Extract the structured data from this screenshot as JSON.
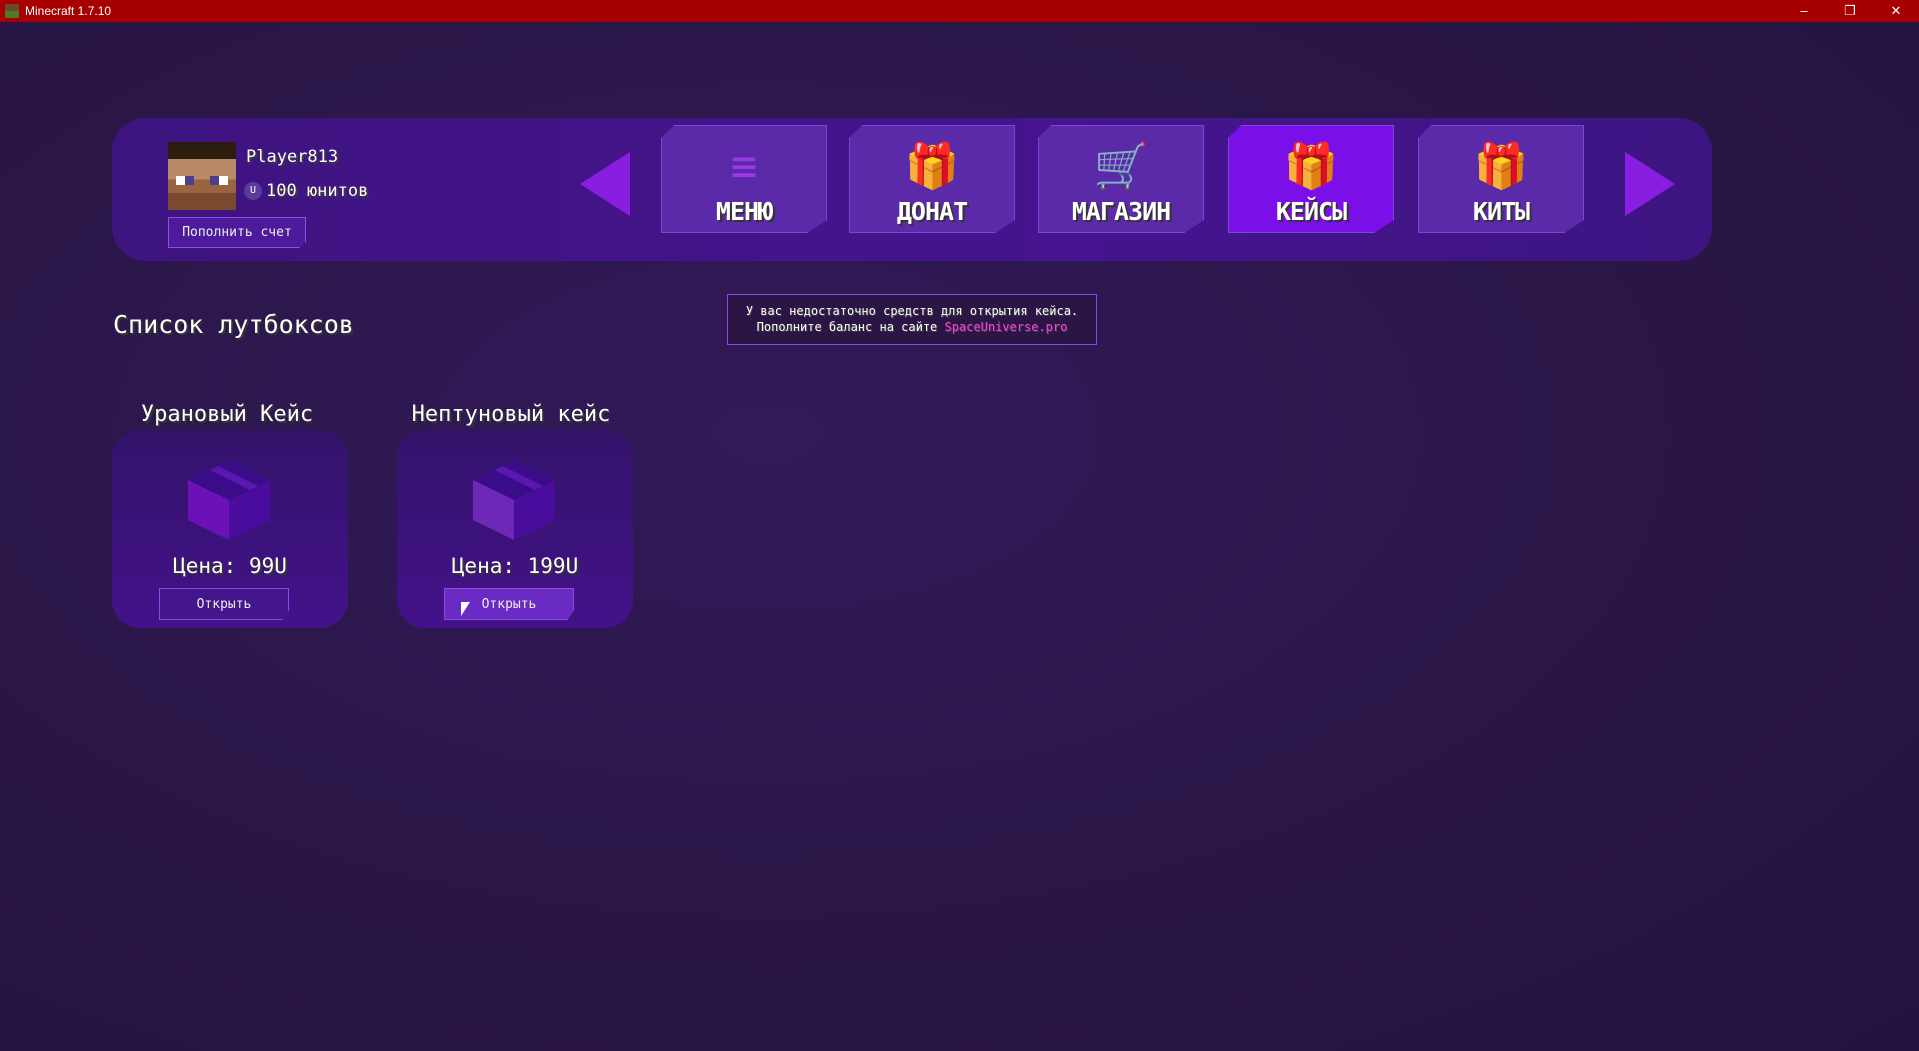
{
  "window": {
    "title": "Minecraft 1.7.10",
    "controls": [
      "–",
      "❐",
      "✕"
    ]
  },
  "profile": {
    "name": "Player813",
    "balance": "100 юнитов",
    "coin_symbol": "U",
    "topup_label": "Пополнить счет"
  },
  "nav": {
    "tabs": [
      {
        "label": "МЕНЮ",
        "icon": "≡",
        "active": false
      },
      {
        "label": "ДОНАТ",
        "icon": "🎁",
        "active": false
      },
      {
        "label": "МАГАЗИН",
        "icon": "🛒",
        "active": false
      },
      {
        "label": "КЕЙСЫ",
        "icon": "🎁",
        "active": true
      },
      {
        "label": "КИТЫ",
        "icon": "🎁",
        "active": false
      }
    ]
  },
  "heading": "Список лутбоксов",
  "notice": {
    "line1": "У вас недостаточно средств для открытия кейса.",
    "line2": "Пополните баланс на сайте ",
    "link": "SpaceUniverse.pro"
  },
  "cases": [
    {
      "title": "Урановый Кейс",
      "price": "Цена: 99U",
      "button": "Открыть"
    },
    {
      "title": "Нептуновый кейс",
      "price": "Цена: 199U",
      "button": "Открыть"
    }
  ],
  "colors": {
    "accent": "#7a0fe8",
    "titlebar": "#a80000",
    "link": "#ff3ce8"
  }
}
